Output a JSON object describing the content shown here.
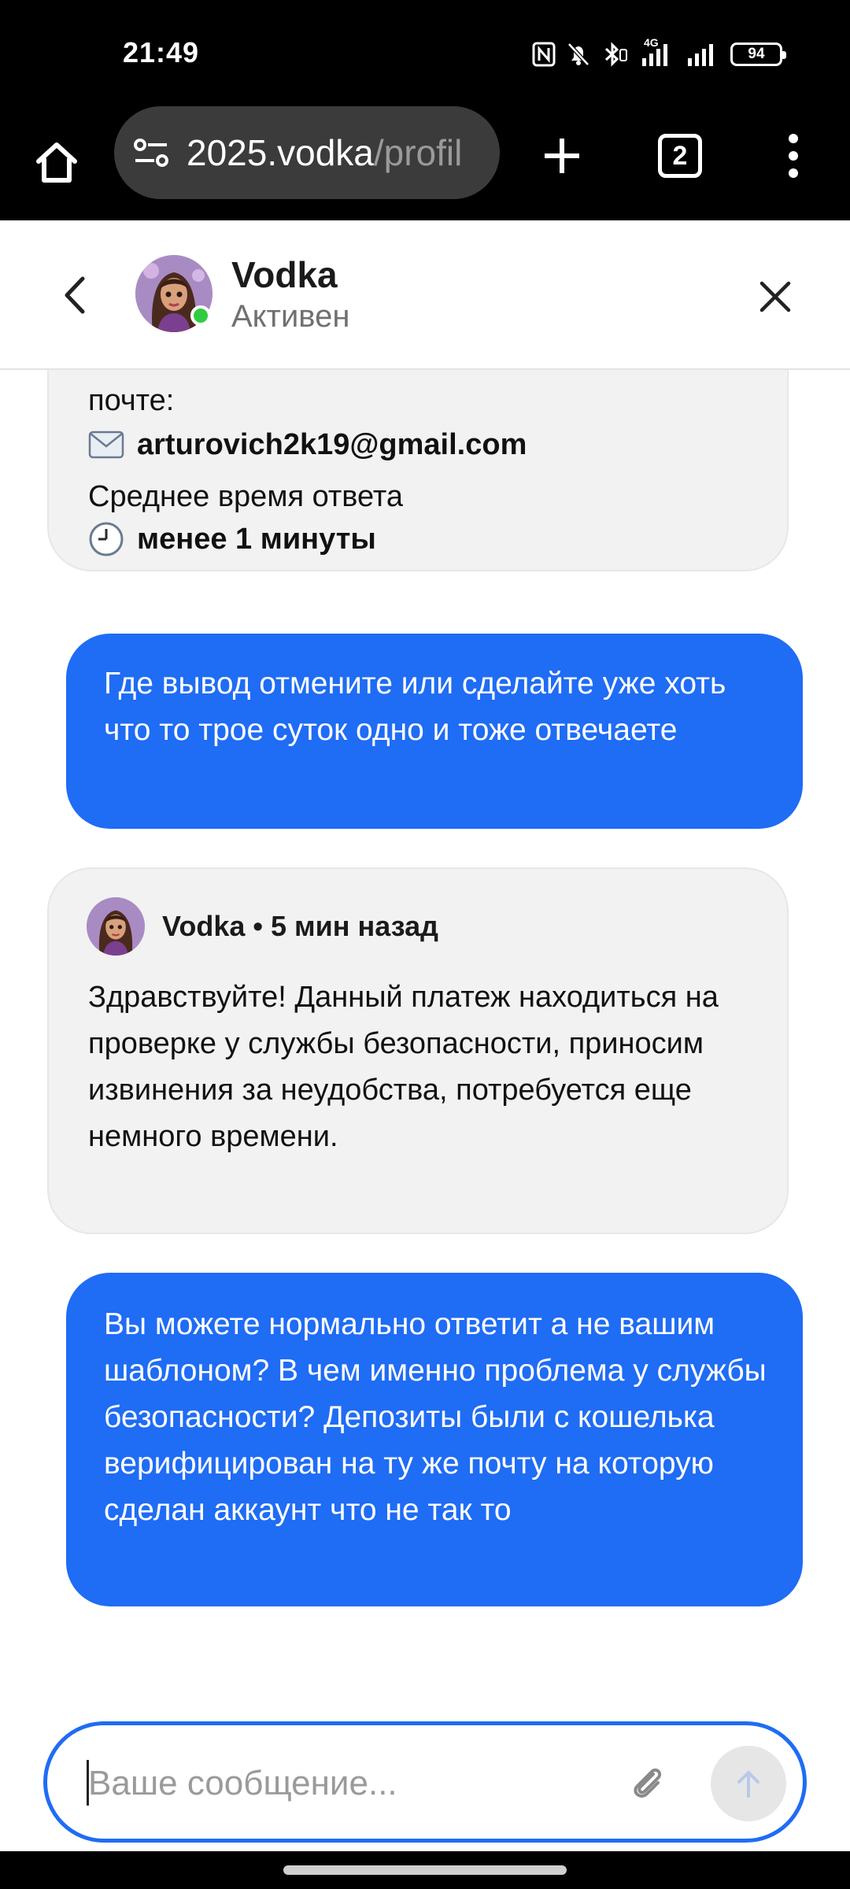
{
  "status_bar": {
    "time": "21:49",
    "network": "4G",
    "battery": "94",
    "icons": [
      "nfc-icon",
      "bell-off-icon",
      "bluetooth-icon",
      "signal-icon",
      "signal-icon",
      "battery-icon"
    ]
  },
  "browser": {
    "url_host": "2025.vodka",
    "url_path": "/profil",
    "tab_count": "2",
    "icons": [
      "home-icon",
      "site-settings-icon",
      "plus-icon",
      "tabs-icon",
      "more-vert-icon"
    ]
  },
  "header": {
    "name": "Vodka",
    "status": "Активен",
    "online_color": "#2ecc40"
  },
  "messages": {
    "info_card": {
      "label_email": "почте:",
      "email": "arturovich2k19@gmail.com",
      "label_response": "Среднее время ответа",
      "response_time": "менее 1 минуты"
    },
    "user_1": "Где вывод отмените или сделайте уже хоть что то трое суток одно и тоже отвечаете",
    "reply": {
      "sender": "Vodka",
      "time": "5 мин назад",
      "meta": "Vodka • 5 мин назад",
      "text": "Здравствуйте! Данный платеж находиться на проверке у службы безопасности, приносим извинения за неудобства, потребуется еще немного времени."
    },
    "user_2": "Вы можете нормально ответит а не вашим шаблоном? В чем именно проблема у службы безопасности? Депозиты были с кошелька верифицирован на ту же почту на которую сделан аккаунт что не так то"
  },
  "composer": {
    "placeholder": "Ваше сообщение...",
    "value": ""
  },
  "colors": {
    "accent": "#1f6cf5",
    "bubble_gray": "#f2f2f2"
  }
}
